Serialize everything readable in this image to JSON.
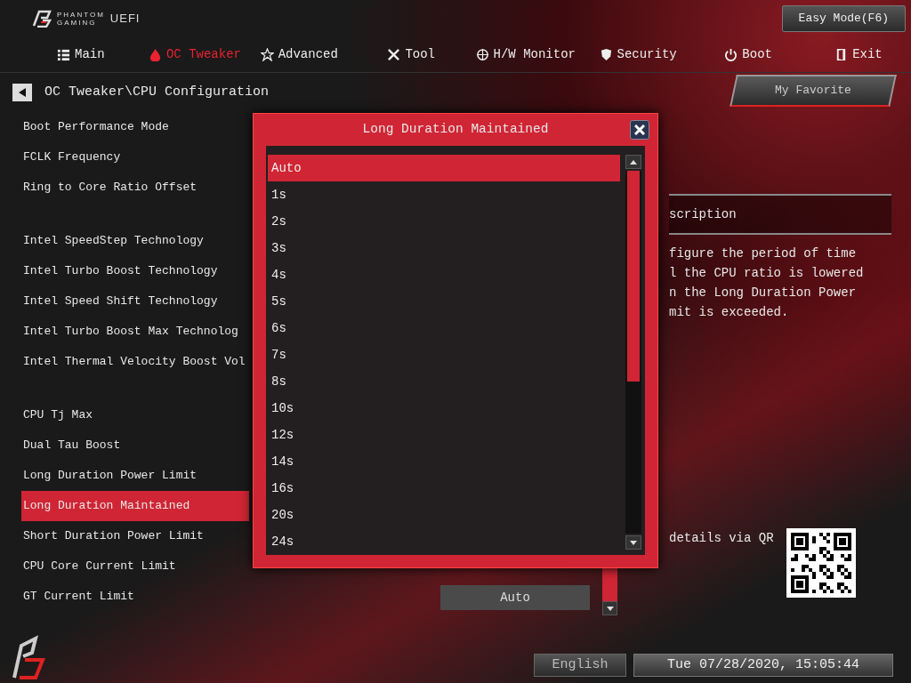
{
  "header": {
    "brand_lines": [
      "PHANTOM",
      "GAMING"
    ],
    "uefi": "UEFI",
    "easy_mode": "Easy Mode(F6)"
  },
  "tabs": [
    {
      "label": "Main",
      "selected": false
    },
    {
      "label": "OC Tweaker",
      "selected": true
    },
    {
      "label": "Advanced",
      "selected": false
    },
    {
      "label": "Tool",
      "selected": false
    },
    {
      "label": "H/W Monitor",
      "selected": false
    },
    {
      "label": "Security",
      "selected": false
    },
    {
      "label": "Boot",
      "selected": false
    },
    {
      "label": "Exit",
      "selected": false
    }
  ],
  "breadcrumb": "OC Tweaker\\CPU Configuration",
  "favorite": "My Favorite",
  "setting_groups": [
    [
      {
        "label": "Boot Performance Mode",
        "selected": false
      },
      {
        "label": "FCLK Frequency",
        "selected": false
      },
      {
        "label": "Ring to Core Ratio Offset",
        "selected": false
      }
    ],
    [
      {
        "label": "Intel SpeedStep Technology",
        "selected": false
      },
      {
        "label": "Intel Turbo Boost Technology",
        "selected": false
      },
      {
        "label": "Intel Speed Shift Technology",
        "selected": false
      },
      {
        "label": "Intel Turbo Boost Max Technolog",
        "selected": false
      },
      {
        "label": "Intel Thermal Velocity Boost Vol",
        "selected": false
      }
    ],
    [
      {
        "label": "CPU Tj Max",
        "selected": false
      },
      {
        "label": "Dual Tau Boost",
        "selected": false
      },
      {
        "label": "Long Duration Power Limit",
        "selected": false
      },
      {
        "label": "Long Duration Maintained",
        "selected": true
      },
      {
        "label": "Short Duration Power Limit",
        "selected": false
      },
      {
        "label": "CPU Core Current Limit",
        "selected": false
      },
      {
        "label": "GT Current Limit",
        "selected": false,
        "value": "Auto"
      }
    ]
  ],
  "description": {
    "title": "scription",
    "lines": [
      "figure the period of time",
      "l the CPU ratio is lowered",
      "n the Long Duration Power",
      "mit is exceeded."
    ]
  },
  "qr_hint": "details via QR",
  "popup": {
    "title": "Long Duration Maintained",
    "options": [
      {
        "label": "Auto",
        "selected": true
      },
      {
        "label": "1s",
        "selected": false
      },
      {
        "label": "2s",
        "selected": false
      },
      {
        "label": "3s",
        "selected": false
      },
      {
        "label": "4s",
        "selected": false
      },
      {
        "label": "5s",
        "selected": false
      },
      {
        "label": "6s",
        "selected": false
      },
      {
        "label": "7s",
        "selected": false
      },
      {
        "label": "8s",
        "selected": false
      },
      {
        "label": "10s",
        "selected": false
      },
      {
        "label": "12s",
        "selected": false
      },
      {
        "label": "14s",
        "selected": false
      },
      {
        "label": "16s",
        "selected": false
      },
      {
        "label": "20s",
        "selected": false
      },
      {
        "label": "24s",
        "selected": false
      }
    ]
  },
  "footer": {
    "language": "English",
    "datetime": "Tue 07/28/2020, 15:05:44"
  }
}
